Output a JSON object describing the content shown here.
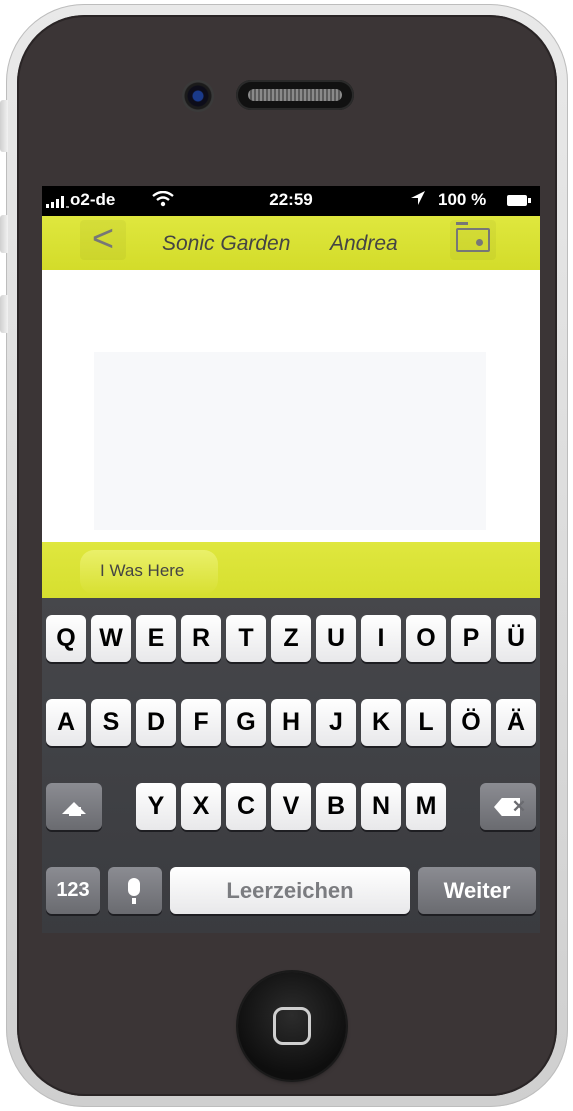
{
  "status_bar": {
    "carrier": "o2-de",
    "time": "22:59",
    "battery": "100 %"
  },
  "nav": {
    "back_label": "<",
    "title_left": "Sonic Garden",
    "title_right": "Andrea"
  },
  "tag": {
    "label": "I Was Here"
  },
  "keyboard": {
    "row1": [
      "Q",
      "W",
      "E",
      "R",
      "T",
      "Z",
      "U",
      "I",
      "O",
      "P",
      "Ü"
    ],
    "row2": [
      "A",
      "S",
      "D",
      "F",
      "G",
      "H",
      "J",
      "K",
      "L",
      "Ö",
      "Ä"
    ],
    "row3": [
      "Y",
      "X",
      "C",
      "V",
      "B",
      "N",
      "M"
    ],
    "numbers_label": "123",
    "space_label": "Leerzeichen",
    "return_label": "Weiter"
  },
  "colors": {
    "accent": "#dfe73e",
    "phone_body": "#3b3536"
  },
  "icons": [
    "signal-icon",
    "wifi-icon",
    "location-arrow-icon",
    "battery-icon",
    "back-chevron-icon",
    "folder-camera-icon",
    "shift-icon",
    "backspace-icon",
    "microphone-icon",
    "home-button-icon"
  ]
}
